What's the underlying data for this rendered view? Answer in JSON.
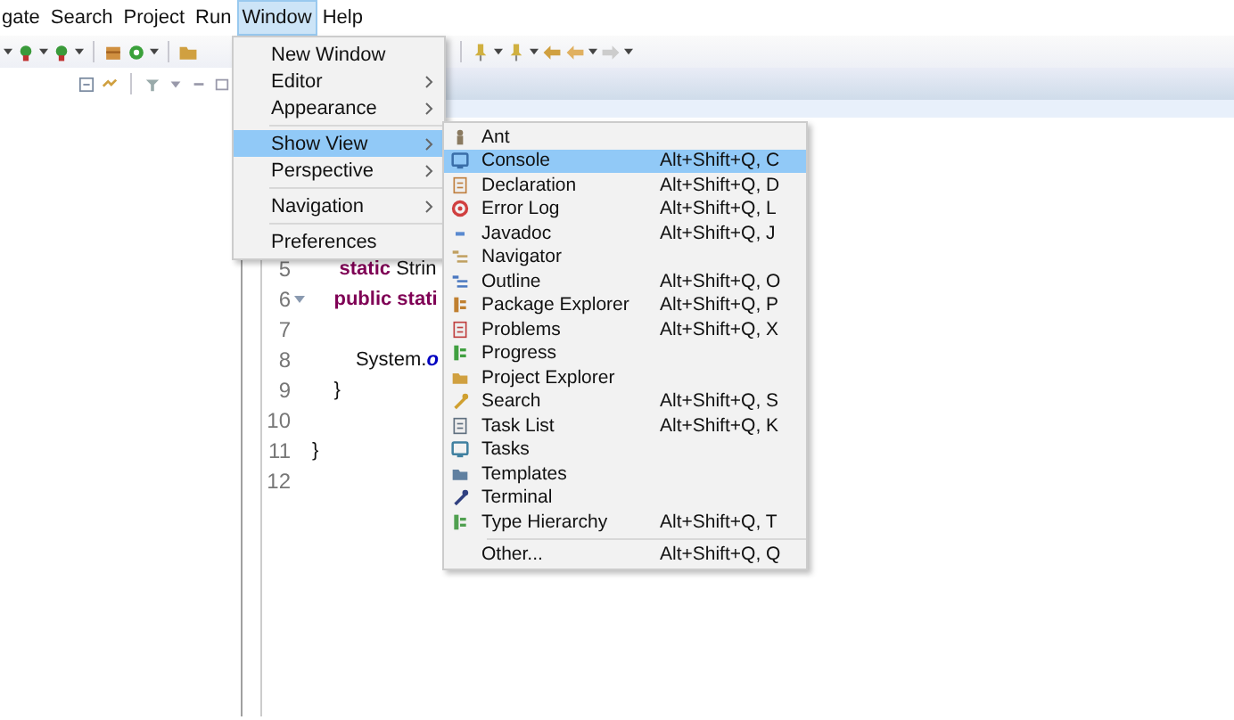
{
  "menu_bar": [
    {
      "label": "gate",
      "selected": false
    },
    {
      "label": "Search",
      "selected": false
    },
    {
      "label": "Project",
      "selected": false
    },
    {
      "label": "Run",
      "selected": false
    },
    {
      "label": "Window",
      "selected": true
    },
    {
      "label": "Help",
      "selected": false
    }
  ],
  "editor": {
    "lines": [
      {
        "number": "5",
        "code": "     **static** Strin"
      },
      {
        "number": "6",
        "folded": true,
        "code": "    **public stati**"
      },
      {
        "number": "7"
      },
      {
        "number": "8",
        "code": "        System.*o*"
      },
      {
        "number": "9",
        "code": "    }"
      },
      {
        "number": "10"
      },
      {
        "number": "11",
        "code": "}"
      },
      {
        "number": "12"
      }
    ]
  },
  "window_menu": {
    "items": [
      {
        "label": "New Window",
        "selected": false
      },
      {
        "label": "Editor",
        "submenu": true,
        "selected": false
      },
      {
        "label": "Appearance",
        "submenu": true,
        "selected": false,
        "separator_after": true
      },
      {
        "label": "Show View",
        "submenu": true,
        "selected": true
      },
      {
        "label": "Perspective",
        "submenu": true,
        "selected": false,
        "separator_after": true
      },
      {
        "label": "Navigation",
        "submenu": true,
        "selected": false,
        "separator_after": true
      },
      {
        "label": "Preferences",
        "selected": false
      }
    ]
  },
  "show_view_menu": {
    "items": [
      {
        "label": "Ant",
        "selected": false
      },
      {
        "label": "Console",
        "shortcut": "Alt+Shift+Q, C",
        "selected": true
      },
      {
        "label": "Declaration",
        "shortcut": "Alt+Shift+Q, D",
        "selected": false
      },
      {
        "label": "Error Log",
        "shortcut": "Alt+Shift+Q, L",
        "selected": false
      },
      {
        "label": "Javadoc",
        "shortcut": "Alt+Shift+Q, J",
        "selected": false
      },
      {
        "label": "Navigator",
        "selected": false
      },
      {
        "label": "Outline",
        "shortcut": "Alt+Shift+Q, O",
        "selected": false
      },
      {
        "label": "Package Explorer",
        "shortcut": "Alt+Shift+Q, P",
        "selected": false
      },
      {
        "label": "Problems",
        "shortcut": "Alt+Shift+Q, X",
        "selected": false
      },
      {
        "label": "Progress",
        "selected": false
      },
      {
        "label": "Project Explorer",
        "selected": false
      },
      {
        "label": "Search",
        "shortcut": "Alt+Shift+Q, S",
        "selected": false
      },
      {
        "label": "Task List",
        "shortcut": "Alt+Shift+Q, K",
        "selected": false
      },
      {
        "label": "Tasks",
        "selected": false
      },
      {
        "label": "Templates",
        "selected": false
      },
      {
        "label": "Terminal",
        "selected": false
      },
      {
        "label": "Type Hierarchy",
        "shortcut": "Alt+Shift+Q, T",
        "selected": false,
        "separator_after": true
      },
      {
        "label": "Other...",
        "shortcut": "Alt+Shift+Q, Q",
        "selected": false
      }
    ]
  }
}
